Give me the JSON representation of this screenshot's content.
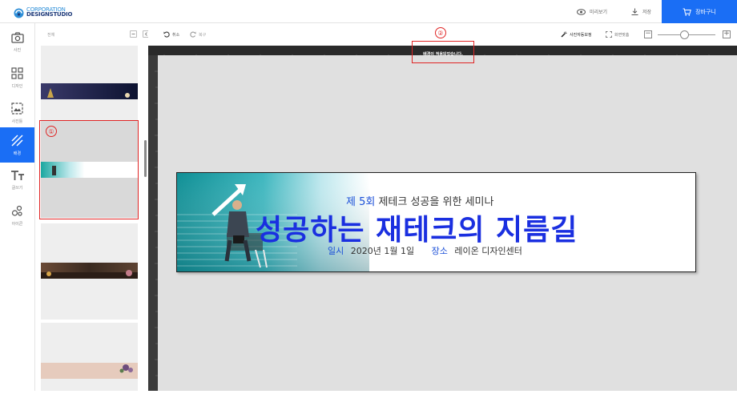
{
  "logo": {
    "line1": "CORPORATION",
    "line2": "DESIGNSTUDIO"
  },
  "topbar": {
    "preview_label": "미리보기",
    "save_label": "저장",
    "cart_label": "장바구니"
  },
  "nav": [
    {
      "label": "사진",
      "icon": "camera-icon"
    },
    {
      "label": "디자인",
      "icon": "grid-icon"
    },
    {
      "label": "사진틀",
      "icon": "frame-icon"
    },
    {
      "label": "배경",
      "icon": "background-icon",
      "active": true
    },
    {
      "label": "글쓰기",
      "icon": "text-icon"
    },
    {
      "label": "아이콘",
      "icon": "shapes-icon"
    }
  ],
  "panel": {
    "filter_label": "전체"
  },
  "canvas_toolbar": {
    "undo_label": "취소",
    "redo_label": "복구",
    "auto_label": "사진자동보정",
    "fit_label": "화면맞춤"
  },
  "toast": "배경이 적용되었습니다.",
  "annotations": {
    "one": "①",
    "two": "②"
  },
  "banner": {
    "line1_accent": "제 5회",
    "line1_rest": " 제테크 성공을 위한 세미나",
    "title": "성공하는 재테크의 지름길",
    "date_label": "일시",
    "date_value": "2020년 1월 1일",
    "place_label": "장소",
    "place_value": "레이온 디자인센터"
  },
  "colors": {
    "accent": "#1a6ef5",
    "annotation": "#e02424",
    "title": "#1a2fe0"
  }
}
